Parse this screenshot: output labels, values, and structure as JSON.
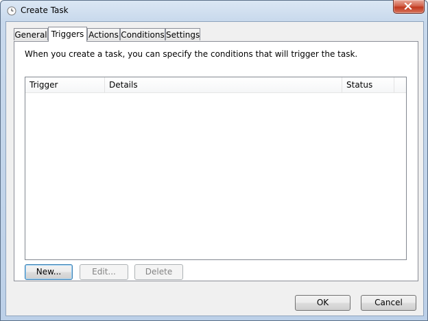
{
  "window": {
    "title": "Create Task"
  },
  "tabs": [
    {
      "label": "General"
    },
    {
      "label": "Triggers"
    },
    {
      "label": "Actions"
    },
    {
      "label": "Conditions"
    },
    {
      "label": "Settings"
    }
  ],
  "active_tab": "Triggers",
  "triggers": {
    "description": "When you create a task, you can specify the conditions that will trigger the task.",
    "columns": [
      "Trigger",
      "Details",
      "Status"
    ],
    "rows": [],
    "buttons": {
      "new": "New...",
      "edit": "Edit...",
      "delete": "Delete"
    }
  },
  "dialog_buttons": {
    "ok": "OK",
    "cancel": "Cancel"
  },
  "colors": {
    "close_button": "#c1391f",
    "focus_border": "#3c7fb1"
  },
  "icons": {
    "window": "clock-icon",
    "close": "close-icon"
  }
}
